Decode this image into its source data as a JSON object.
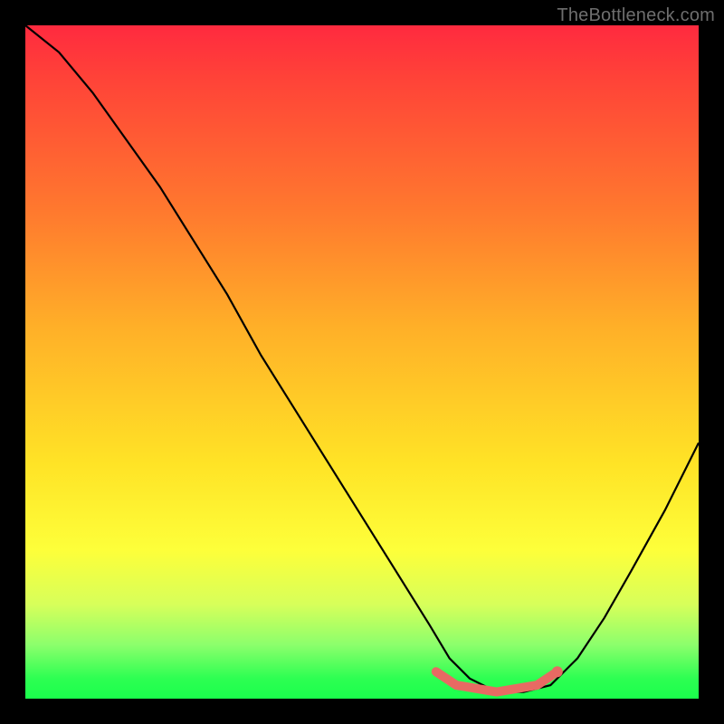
{
  "watermark": "TheBottleneck.com",
  "chart_data": {
    "type": "line",
    "title": "",
    "xlabel": "",
    "ylabel": "",
    "xlim": [
      0,
      100
    ],
    "ylim": [
      0,
      100
    ],
    "series": [
      {
        "name": "bottleneck-curve",
        "x": [
          0,
          5,
          10,
          15,
          20,
          25,
          30,
          35,
          40,
          45,
          50,
          55,
          60,
          63,
          66,
          70,
          74,
          78,
          82,
          86,
          90,
          95,
          100
        ],
        "values": [
          100,
          96,
          90,
          83,
          76,
          68,
          60,
          51,
          43,
          35,
          27,
          19,
          11,
          6,
          3,
          1,
          1,
          2,
          6,
          12,
          19,
          28,
          38
        ]
      },
      {
        "name": "highlight-band",
        "x": [
          61,
          64,
          67,
          70,
          73,
          76,
          79
        ],
        "values": [
          4,
          2,
          1.5,
          1,
          1.5,
          2,
          4
        ]
      }
    ],
    "annotations": [],
    "colors": {
      "curve": "#000000",
      "highlight": "#e86a63",
      "gradient_top": "#ff2a3f",
      "gradient_mid": "#ffe326",
      "gradient_bottom": "#1aff4c"
    }
  }
}
